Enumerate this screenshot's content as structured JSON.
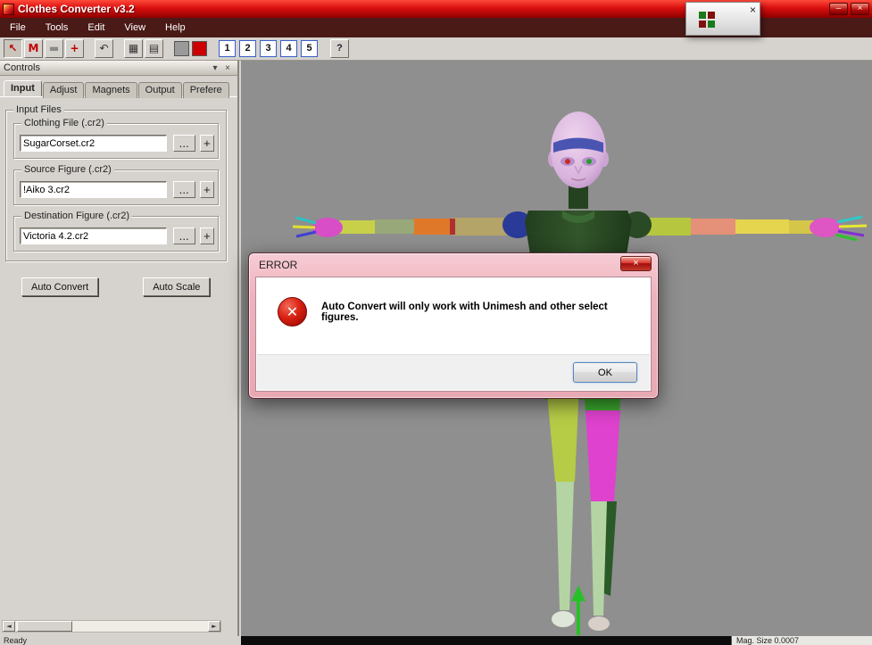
{
  "window": {
    "title": "Clothes Converter v3.2",
    "minimize_glyph": "–",
    "close_glyph": "×"
  },
  "mini_window": {
    "close_glyph": "×"
  },
  "menu": {
    "items": [
      "File",
      "Tools",
      "Edit",
      "View",
      "Help"
    ]
  },
  "toolbar": {
    "pointer_glyph": "↖",
    "magnet_glyph": "M",
    "brush_glyph": "▬",
    "move_glyph": "+",
    "undo_glyph": "↶",
    "grid_glyph": "▦",
    "panes_glyph": "▤",
    "numbers": [
      "1",
      "2",
      "3",
      "4",
      "5"
    ],
    "help_glyph": "?",
    "gray_swatch_color": "#9a9a9a",
    "red_swatch_color": "#cc0000"
  },
  "panel": {
    "title": "Controls",
    "pin_glyph": "▾",
    "close_glyph": "×",
    "tabs": [
      "Input",
      "Adjust",
      "Magnets",
      "Output",
      "Prefere"
    ],
    "active_tab": "Input",
    "group_title": "Input Files",
    "fields": [
      {
        "label": "Clothing File (.cr2)",
        "value": "SugarCorset.cr2",
        "browse": "...",
        "add": "+"
      },
      {
        "label": "Source Figure (.cr2)",
        "value": "!Aiko 3.cr2",
        "browse": "...",
        "add": "+"
      },
      {
        "label": "Destination Figure (.cr2)",
        "value": "Victoria 4.2.cr2",
        "browse": "...",
        "add": "+"
      }
    ],
    "auto_convert_label": "Auto Convert",
    "auto_scale_label": "Auto Scale",
    "hscroll_left_glyph": "◄",
    "hscroll_right_glyph": "►"
  },
  "dialog": {
    "title": "ERROR",
    "close_glyph": "×",
    "error_icon_glyph": "✕",
    "message": "Auto Convert will only work with Unimesh and other select figures.",
    "ok_label": "OK"
  },
  "status": {
    "left": "Ready",
    "right": "Mag. Size 0.0007"
  },
  "colors": {
    "titlebar_red": "#c40000",
    "menubar_maroon": "#4a1a17",
    "viewport_gray": "#8f8f8f",
    "dialog_frame_pink": "#eeb2bd",
    "error_red": "#d92212",
    "number_button_border_blue": "#3a5fc8"
  }
}
